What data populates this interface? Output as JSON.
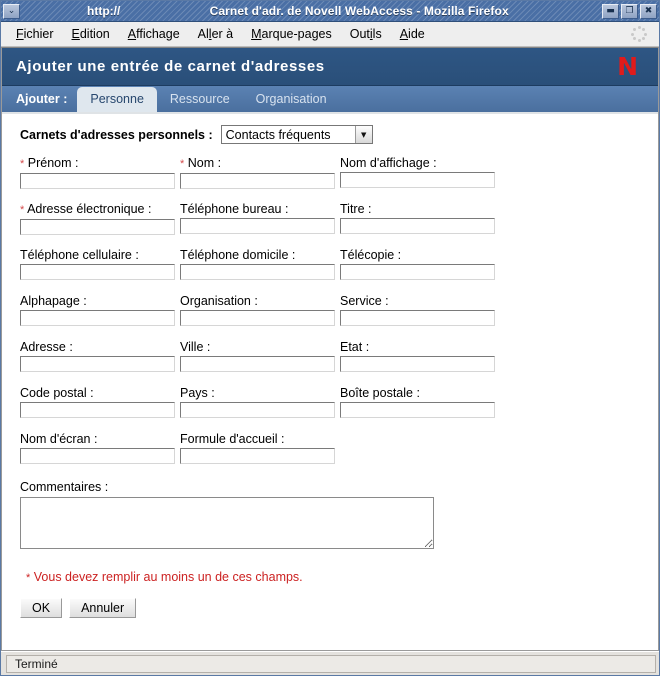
{
  "window": {
    "url_text": "http://",
    "title": "Carnet d'adr. de Novell WebAccess - Mozilla Firefox",
    "menu_button_icon": "chevron-down-icon",
    "minimize_label": "▬",
    "maximize_label": "❐",
    "close_label": "✖"
  },
  "menubar": {
    "items": [
      {
        "label": "Fichier",
        "accel": "F"
      },
      {
        "label": "Edition",
        "accel": "E"
      },
      {
        "label": "Affichage",
        "accel": "A"
      },
      {
        "label": "Aller à",
        "accel": "l"
      },
      {
        "label": "Marque-pages",
        "accel": "M"
      },
      {
        "label": "Outils",
        "accel": "i"
      },
      {
        "label": "Aide",
        "accel": "A"
      }
    ]
  },
  "app": {
    "header_title": "Ajouter une entrée de carnet d'adresses",
    "logo_text": "N",
    "logo_color": "#e01b1b",
    "header_bg": "#2e5684",
    "tabstrip_bg": "#5b82b3"
  },
  "tabs": {
    "prefix_label": "Ajouter :",
    "items": [
      {
        "label": "Personne",
        "active": true
      },
      {
        "label": "Ressource",
        "active": false
      },
      {
        "label": "Organisation",
        "active": false
      }
    ]
  },
  "addressbook": {
    "label": "Carnets d'adresses personnels :",
    "selected": "Contacts fréquents"
  },
  "form": {
    "required_marker": "*",
    "rows": [
      [
        {
          "label": "Prénom :",
          "required": true,
          "value": ""
        },
        {
          "label": "Nom :",
          "required": true,
          "value": ""
        },
        {
          "label": "Nom d'affichage :",
          "required": false,
          "value": ""
        }
      ],
      [
        {
          "label": "Adresse électronique :",
          "required": true,
          "value": ""
        },
        {
          "label": "Téléphone bureau :",
          "required": false,
          "value": ""
        },
        {
          "label": "Titre :",
          "required": false,
          "value": ""
        }
      ],
      [
        {
          "label": "Téléphone cellulaire :",
          "required": false,
          "value": ""
        },
        {
          "label": "Téléphone domicile :",
          "required": false,
          "value": ""
        },
        {
          "label": "Télécopie :",
          "required": false,
          "value": ""
        }
      ],
      [
        {
          "label": "Alphapage :",
          "required": false,
          "value": ""
        },
        {
          "label": "Organisation :",
          "required": false,
          "value": ""
        },
        {
          "label": "Service :",
          "required": false,
          "value": ""
        }
      ],
      [
        {
          "label": "Adresse :",
          "required": false,
          "value": ""
        },
        {
          "label": "Ville :",
          "required": false,
          "value": ""
        },
        {
          "label": "Etat :",
          "required": false,
          "value": ""
        }
      ],
      [
        {
          "label": "Code postal :",
          "required": false,
          "value": ""
        },
        {
          "label": "Pays :",
          "required": false,
          "value": ""
        },
        {
          "label": "Boîte postale :",
          "required": false,
          "value": ""
        }
      ],
      [
        {
          "label": "Nom d'écran :",
          "required": false,
          "value": ""
        },
        {
          "label": "Formule d'accueil :",
          "required": false,
          "value": ""
        },
        {
          "label": "",
          "required": false,
          "value": "",
          "hidden": true
        }
      ]
    ],
    "comments_label": "Commentaires :",
    "comments_value": "",
    "note": "Vous devez remplir au moins un de ces champs.",
    "note_color": "#cc2222",
    "ok_label": "OK",
    "cancel_label": "Annuler"
  },
  "statusbar": {
    "text": "Terminé"
  }
}
